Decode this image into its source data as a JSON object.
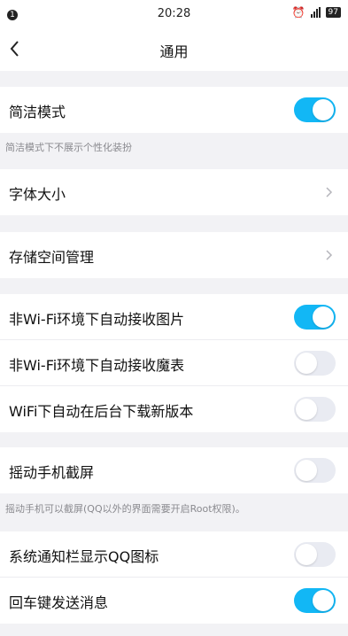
{
  "status_bar": {
    "notification_count": "1",
    "time": "20:28",
    "alarm_icon": "alarm-icon",
    "signal_icon": "signal-icon",
    "battery": "97"
  },
  "header": {
    "back_icon": "chevron-left-icon",
    "title": "通用"
  },
  "settings": {
    "simple_mode": {
      "label": "简洁模式",
      "enabled": true
    },
    "simple_mode_caption": "简洁模式下不展示个性化装扮",
    "font_size": {
      "label": "字体大小"
    },
    "storage": {
      "label": "存储空间管理"
    },
    "auto_receive_images": {
      "label": "非Wi-Fi环境下自动接收图片",
      "enabled": true
    },
    "auto_receive_magic": {
      "label": "非Wi-Fi环境下自动接收魔表",
      "enabled": false
    },
    "auto_download_update": {
      "label": "WiFi下自动在后台下载新版本",
      "enabled": false
    },
    "shake_screenshot": {
      "label": "摇动手机截屏",
      "enabled": false
    },
    "shake_caption": "摇动手机可以截屏(QQ以外的界面需要开启Root权限)。",
    "notify_bar_icon": {
      "label": "系统通知栏显示QQ图标",
      "enabled": false
    },
    "enter_send": {
      "label": "回车键发送消息",
      "enabled": true
    }
  },
  "colors": {
    "toggle_on": "#12b7f5",
    "toggle_off": "#e9ebf2",
    "background": "#f2f2f5"
  }
}
